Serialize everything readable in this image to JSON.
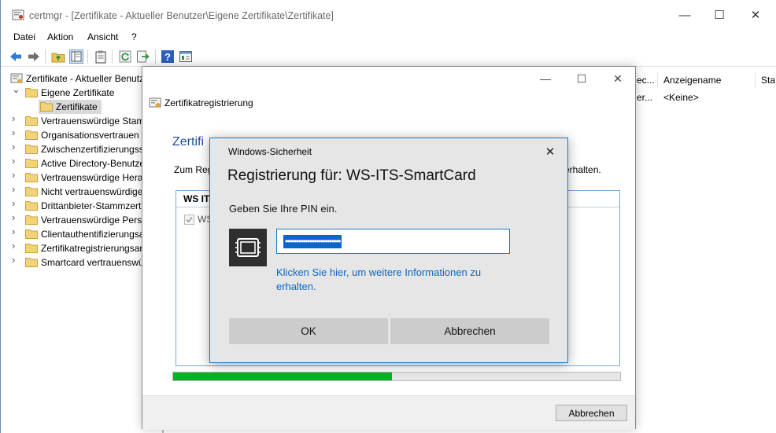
{
  "window": {
    "title": "certmgr - [Zertifikate - Aktueller Benutzer\\Eigene Zertifikate\\Zertifikate]",
    "minimize": "—",
    "maximize": "☐",
    "close": "✕"
  },
  "menu": [
    "Datei",
    "Aktion",
    "Ansicht",
    "?"
  ],
  "toolbar_icons": [
    "back-icon",
    "forward-icon",
    "up-folder-icon",
    "show-hide-tree-icon",
    "clipboard-icon",
    "refresh-icon",
    "export-icon",
    "help-icon",
    "properties-icon"
  ],
  "tree": {
    "root": "Zertifikate - Aktueller Benutzer",
    "items": [
      {
        "label": "Eigene Zertifikate",
        "expanded": true
      },
      {
        "label": "Zertifikate",
        "selected": true,
        "child": true
      },
      {
        "label": "Vertrauenswürdige Stamm"
      },
      {
        "label": "Organisationsvertrauen"
      },
      {
        "label": "Zwischenzertifizierungsst"
      },
      {
        "label": "Active Directory-Benutze"
      },
      {
        "label": "Vertrauenswürdige Herau"
      },
      {
        "label": "Nicht vertrauenswürdige"
      },
      {
        "label": "Drittanbieter-Stammzerti"
      },
      {
        "label": "Vertrauenswürdige Perso"
      },
      {
        "label": "Clientauthentifizierungsa"
      },
      {
        "label": "Zertifikatregistrierungsar"
      },
      {
        "label": "Smartcard vertrauenswür"
      }
    ]
  },
  "list": {
    "columns": [
      "ec...",
      "Anzeigename",
      "Sta"
    ],
    "row": [
      "er...",
      "<Keine>"
    ]
  },
  "enroll_dialog": {
    "caption": "Zertifikatregistrierung",
    "heading": "Zertifi",
    "description": "Zum Reg",
    "description_tail": "erhalten.",
    "box_header": "WS IT",
    "checkbox_label": "WS",
    "progress_percent": 49,
    "cancel": "Abbrechen",
    "minimize": "—",
    "maximize": "☐",
    "close": "✕"
  },
  "security_dialog": {
    "title": "Windows-Sicherheit",
    "close": "✕",
    "heading": "Registrierung für: WS-ITS-SmartCard",
    "prompt": "Geben Sie Ihre PIN ein.",
    "pin_masked": "•••••••••••••••••••••••••",
    "link": "Klicken Sie hier, um weitere Informationen zu erhalten.",
    "ok": "OK",
    "cancel": "Abbrechen"
  },
  "colors": {
    "accent": "#1979ca",
    "link": "#0a66c2",
    "progress": "#06b025",
    "heading_blue": "#1c4e9a"
  }
}
